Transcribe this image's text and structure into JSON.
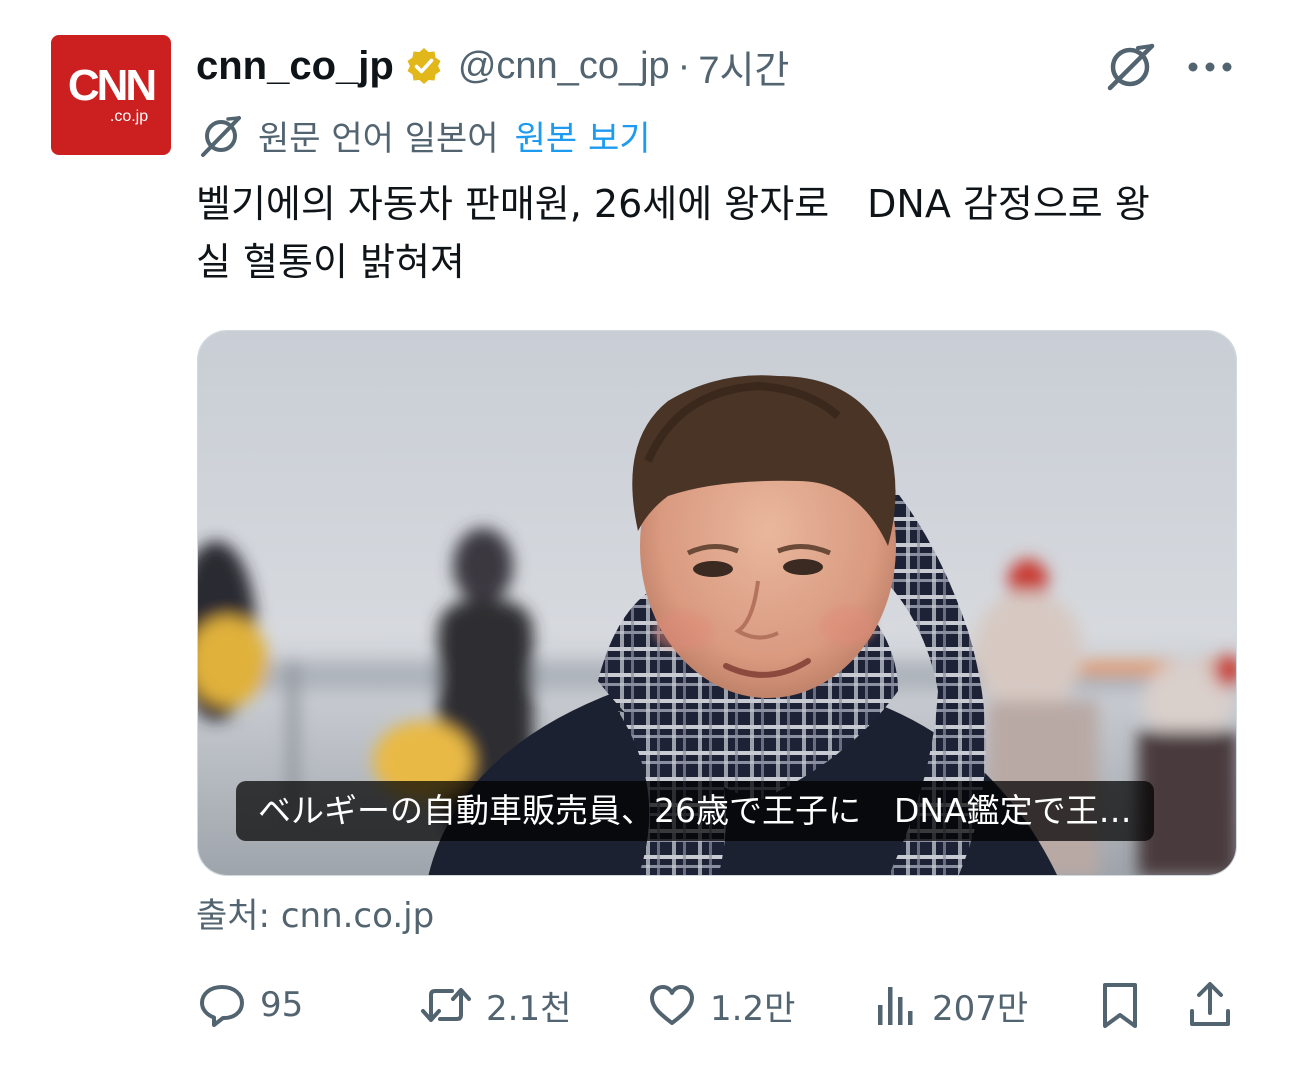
{
  "avatar": {
    "logo_main": "CNN",
    "logo_sub": ".co.jp",
    "color": "#cc1f1f"
  },
  "header": {
    "display_name": "cnn_co_jp",
    "verified_icon": "verified-gold-badge",
    "handle": "@cnn_co_jp",
    "separator": "·",
    "time": "7시간",
    "grok_icon": "grok-icon",
    "more_icon": "more-horizontal-icon"
  },
  "translation": {
    "icon": "translate-icon",
    "label": "원문 언어 일본어",
    "link": "원본 보기",
    "link_color": "#1d9bf0"
  },
  "tweet": {
    "text": "벨기에의 자동차 판매원, 26세에 왕자로　DNA 감정으로 왕\n실 혈통이 밝혀져"
  },
  "card": {
    "caption": "ベルギーの自動車販売員、26歳で王子に　DNA鑑定で王…",
    "image": "photo of a young man wearing a plaid scarf outdoors"
  },
  "source": "출처: cnn.co.jp",
  "actions": {
    "reply": {
      "icon": "reply-icon",
      "count": "95"
    },
    "retweet": {
      "icon": "retweet-icon",
      "count": "2.1천"
    },
    "like": {
      "icon": "heart-icon",
      "count": "1.2만"
    },
    "views": {
      "icon": "views-chart-icon",
      "count": "207만"
    },
    "bookmark": {
      "icon": "bookmark-icon"
    },
    "share": {
      "icon": "share-icon"
    }
  }
}
